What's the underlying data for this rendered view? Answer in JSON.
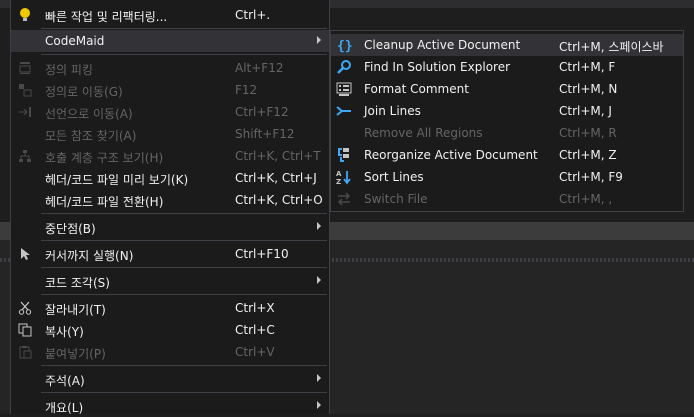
{
  "main_menu": {
    "items": [
      {
        "label": "빠른 작업 및 리팩터링...",
        "shortcut": "Ctrl+."
      },
      {
        "label": "CodeMaid",
        "shortcut": ""
      },
      {
        "label": "정의 피킹",
        "shortcut": "Alt+F12"
      },
      {
        "label": "정의로 이동(G)",
        "shortcut": "F12"
      },
      {
        "label": "선언으로 이동(A)",
        "shortcut": "Ctrl+F12"
      },
      {
        "label": "모든 참조 찾기(A)",
        "shortcut": "Shift+F12"
      },
      {
        "label": "호출 계층 구조 보기(H)",
        "shortcut": "Ctrl+K, Ctrl+T"
      },
      {
        "label": "헤더/코드 파일 미리 보기(K)",
        "shortcut": "Ctrl+K, Ctrl+J"
      },
      {
        "label": "헤더/코드 파일 전환(H)",
        "shortcut": "Ctrl+K, Ctrl+O"
      },
      {
        "label": "중단점(B)",
        "shortcut": ""
      },
      {
        "label": "커서까지 실행(N)",
        "shortcut": "Ctrl+F10"
      },
      {
        "label": "코드 조각(S)",
        "shortcut": ""
      },
      {
        "label": "잘라내기(T)",
        "shortcut": "Ctrl+X"
      },
      {
        "label": "복사(Y)",
        "shortcut": "Ctrl+C"
      },
      {
        "label": "붙여넣기(P)",
        "shortcut": "Ctrl+V"
      },
      {
        "label": "주석(A)",
        "shortcut": ""
      },
      {
        "label": "개요(L)",
        "shortcut": ""
      }
    ]
  },
  "submenu": {
    "items": [
      {
        "label": "Cleanup Active Document",
        "shortcut": "Ctrl+M, 스페이스바"
      },
      {
        "label": "Find In Solution Explorer",
        "shortcut": "Ctrl+M, F"
      },
      {
        "label": "Format Comment",
        "shortcut": "Ctrl+M, N"
      },
      {
        "label": "Join Lines",
        "shortcut": "Ctrl+M, J"
      },
      {
        "label": "Remove All Regions",
        "shortcut": "Ctrl+M, R"
      },
      {
        "label": "Reorganize Active Document",
        "shortcut": "Ctrl+M, Z"
      },
      {
        "label": "Sort Lines",
        "shortcut": "Ctrl+M, F9"
      },
      {
        "label": "Switch File",
        "shortcut": "Ctrl+M, ,"
      }
    ]
  },
  "colors": {
    "accent_icon": "#3ea8f4",
    "lightbulb": "#f0c800",
    "menu_bg": "#1b1b1c",
    "highlight": "#333337"
  }
}
